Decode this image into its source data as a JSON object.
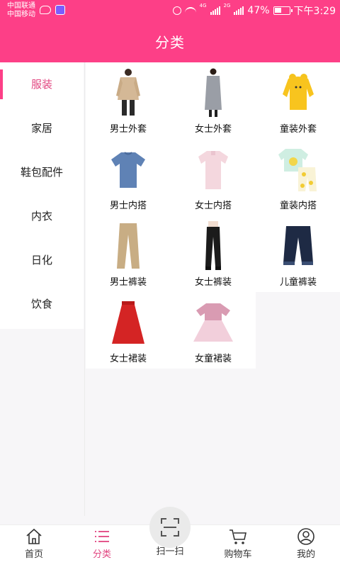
{
  "status": {
    "carrier1": "中国联通",
    "carrier2": "中国移动",
    "network": "4G",
    "network2": "2G",
    "battery": "47%",
    "battery_level": 0.47,
    "time": "下午3:29"
  },
  "header": {
    "title": "分类"
  },
  "sidebar": {
    "items": [
      {
        "label": "服装",
        "active": true
      },
      {
        "label": "家居"
      },
      {
        "label": "鞋包配件"
      },
      {
        "label": "内衣"
      },
      {
        "label": "日化"
      },
      {
        "label": "饮食"
      }
    ]
  },
  "grid": {
    "items": [
      {
        "label": "男士外套",
        "icon": "mens-coat-image"
      },
      {
        "label": "女士外套",
        "icon": "womens-coat-image"
      },
      {
        "label": "童装外套",
        "icon": "kids-coat-image"
      },
      {
        "label": "男士内搭",
        "icon": "mens-tshirt-image"
      },
      {
        "label": "女士内搭",
        "icon": "womens-top-image"
      },
      {
        "label": "童装内搭",
        "icon": "kids-top-image"
      },
      {
        "label": "男士裤装",
        "icon": "mens-pants-image"
      },
      {
        "label": "女士裤装",
        "icon": "womens-pants-image"
      },
      {
        "label": "儿童裤装",
        "icon": "kids-jeans-image"
      },
      {
        "label": "女士裙装",
        "icon": "womens-skirt-image"
      },
      {
        "label": "女童裙装",
        "icon": "girls-dress-image"
      }
    ]
  },
  "bottom_nav": [
    {
      "label": "首页",
      "icon": "home-icon"
    },
    {
      "label": "分类",
      "icon": "category-icon",
      "active": true
    },
    {
      "label": "扫一扫",
      "icon": "scan-icon"
    },
    {
      "label": "购物车",
      "icon": "cart-icon"
    },
    {
      "label": "我的",
      "icon": "user-icon"
    }
  ],
  "colors": {
    "brand": "#fd3f87",
    "active_text": "#e1447f"
  }
}
